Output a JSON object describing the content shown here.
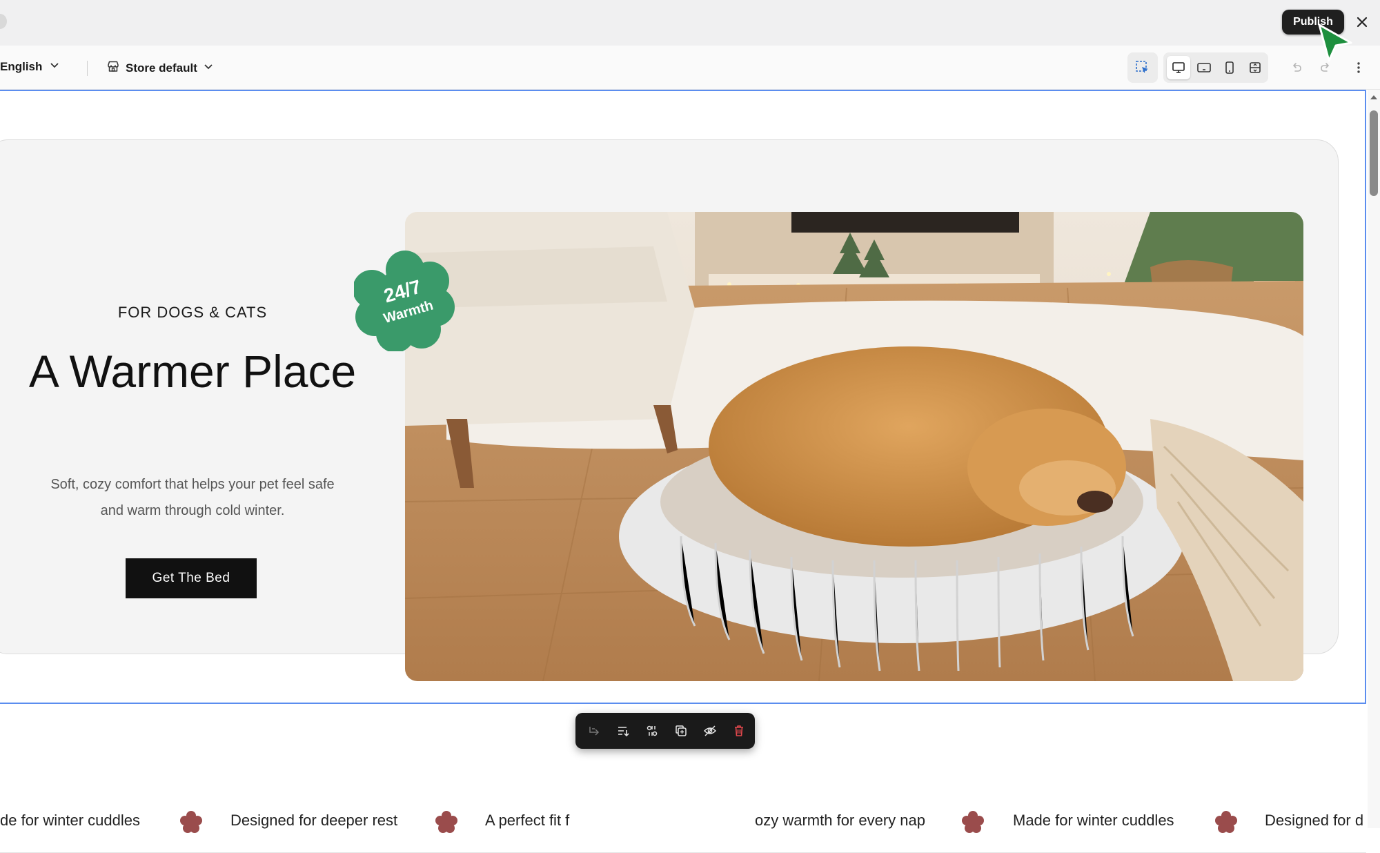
{
  "topbar": {
    "publish_label": "Publish"
  },
  "toolbar": {
    "language": "English",
    "store": "Store default"
  },
  "hero": {
    "eyebrow": "FOR DOGS & CATS",
    "headline": "A Warmer Place",
    "subtext": "Soft, cozy comfort that helps your pet feel safe and warm through cold winter.",
    "cta_label": "Get The Bed",
    "badge_line1": "24/7",
    "badge_line2": "Warmth",
    "badge_color": "#3a9a6a"
  },
  "marquee": {
    "items": [
      "de for winter cuddles",
      "Designed for deeper rest",
      "A perfect fit f",
      "ozy warmth for every nap",
      "Made for winter cuddles",
      "Designed for d"
    ],
    "flower_color": "#9a4c4c"
  },
  "colors": {
    "selection": "#5b8def",
    "cursor": "#1e8f3e",
    "delete": "#e5484d"
  }
}
